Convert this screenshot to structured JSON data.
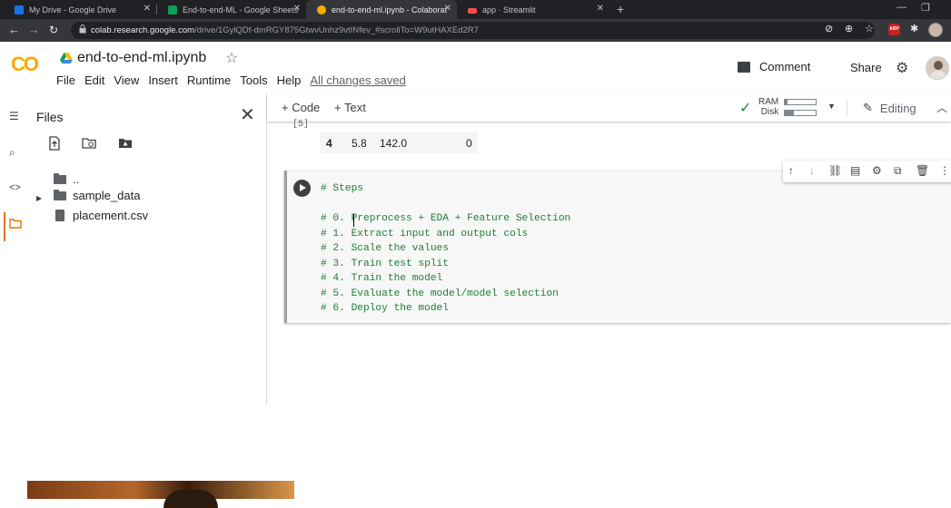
{
  "browser": {
    "tabs": [
      {
        "title": "My Drive - Google Drive",
        "favicon_color": "#1a73e8"
      },
      {
        "title": "End-to-end-ML - Google Sheets",
        "favicon_color": "#0f9d58"
      },
      {
        "title": "end-to-end-ml.ipynb - Colaborat",
        "favicon_color": "#f9ab00"
      },
      {
        "title": "app · Streamlit",
        "favicon_color": "#ff4b4b"
      }
    ],
    "url_host": "colab.research.google.com",
    "url_path": "/drive/1GylQDf-dmRGY875GtwvUnhz9vtINfev_#scrollTo=W9utHAXEd2R7",
    "abp_label": "ABP"
  },
  "colab": {
    "logo": "CO",
    "notebook_title": "end-to-end-ml.ipynb",
    "menu": [
      "File",
      "Edit",
      "View",
      "Insert",
      "Runtime",
      "Tools",
      "Help"
    ],
    "saved_status": "All changes saved",
    "comment_label": "Comment",
    "share_label": "Share"
  },
  "files": {
    "title": "Files",
    "tree": [
      {
        "name": "..",
        "type": "parent"
      },
      {
        "name": "sample_data",
        "type": "folder"
      },
      {
        "name": "placement.csv",
        "type": "file"
      }
    ]
  },
  "toolbar": {
    "code_label": "+ Code",
    "text_label": "+ Text",
    "ram_label": "RAM",
    "disk_label": "Disk",
    "ram_usage": 0.08,
    "disk_usage": 0.3,
    "editing_label": "Editing"
  },
  "output": {
    "prompt": "[5]",
    "row": [
      "4",
      "5.8",
      "142.0",
      "0"
    ]
  },
  "cell": {
    "lines": [
      "# Steps",
      "",
      "# 0. Preprocess + EDA + Feature Selection",
      "# 1. Extract input and output cols",
      "# 2. Scale the values",
      "# 3. Train test split",
      "# 4. Train the model",
      "# 5. Evaluate the model/model selection",
      "# 6. Deploy the model"
    ]
  }
}
